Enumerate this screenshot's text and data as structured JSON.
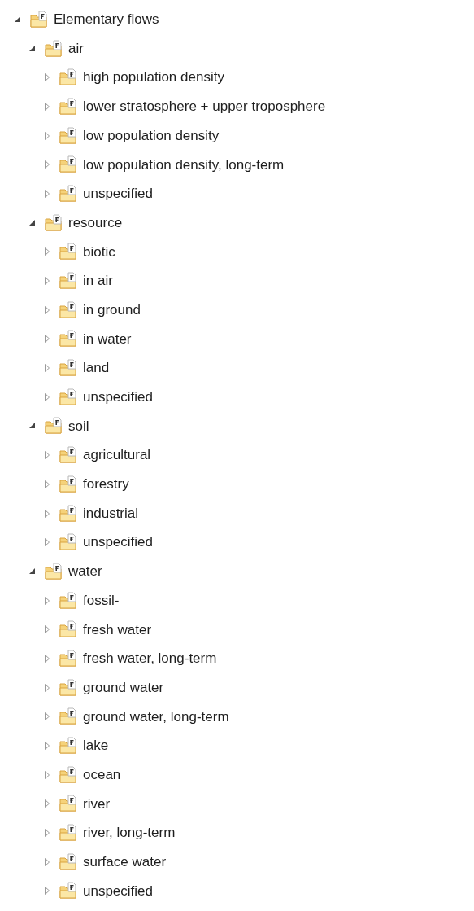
{
  "tree": [
    {
      "label": "Elementary flows",
      "expanded": true,
      "children": [
        {
          "label": "air",
          "expanded": true,
          "children": [
            {
              "label": "high population density",
              "expanded": false
            },
            {
              "label": "lower stratosphere + upper troposphere",
              "expanded": false
            },
            {
              "label": "low population density",
              "expanded": false
            },
            {
              "label": "low population density, long-term",
              "expanded": false
            },
            {
              "label": "unspecified",
              "expanded": false
            }
          ]
        },
        {
          "label": "resource",
          "expanded": true,
          "children": [
            {
              "label": "biotic",
              "expanded": false
            },
            {
              "label": "in air",
              "expanded": false
            },
            {
              "label": "in ground",
              "expanded": false
            },
            {
              "label": "in water",
              "expanded": false
            },
            {
              "label": "land",
              "expanded": false
            },
            {
              "label": "unspecified",
              "expanded": false
            }
          ]
        },
        {
          "label": "soil",
          "expanded": true,
          "children": [
            {
              "label": "agricultural",
              "expanded": false
            },
            {
              "label": "forestry",
              "expanded": false
            },
            {
              "label": "industrial",
              "expanded": false
            },
            {
              "label": "unspecified",
              "expanded": false
            }
          ]
        },
        {
          "label": "water",
          "expanded": true,
          "children": [
            {
              "label": "fossil-",
              "expanded": false
            },
            {
              "label": "fresh water",
              "expanded": false
            },
            {
              "label": "fresh water, long-term",
              "expanded": false
            },
            {
              "label": "ground water",
              "expanded": false
            },
            {
              "label": "ground water, long-term",
              "expanded": false
            },
            {
              "label": "lake",
              "expanded": false
            },
            {
              "label": "ocean",
              "expanded": false
            },
            {
              "label": "river",
              "expanded": false
            },
            {
              "label": "river, long-term",
              "expanded": false
            },
            {
              "label": "surface water",
              "expanded": false
            },
            {
              "label": "unspecified",
              "expanded": false
            }
          ]
        }
      ]
    }
  ]
}
